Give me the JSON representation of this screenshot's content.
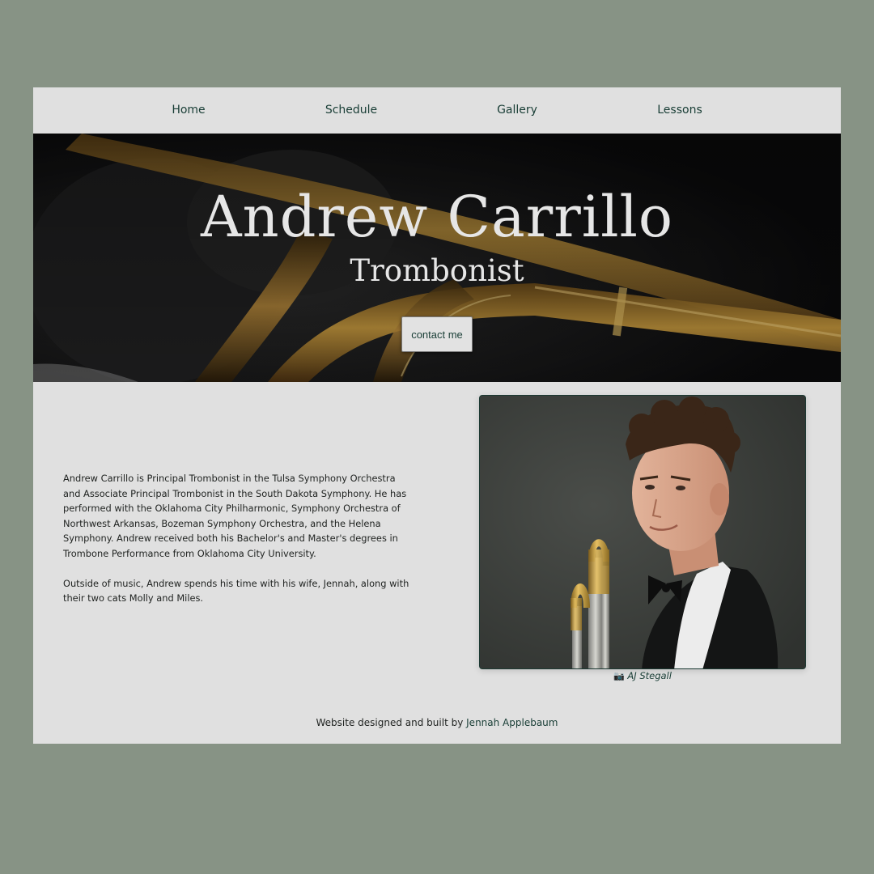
{
  "nav": {
    "items": [
      {
        "label": "Home"
      },
      {
        "label": "Schedule"
      },
      {
        "label": "Gallery"
      },
      {
        "label": "Lessons"
      }
    ]
  },
  "hero": {
    "title": "Andrew Carrillo",
    "subtitle": "Trombonist",
    "button_label": "contact me"
  },
  "bio": {
    "paragraphs": [
      "Andrew Carrillo is Principal Trombonist in the Tulsa Symphony Orchestra and Associate Principal Trombonist in the South Dakota Symphony. He has performed with the Oklahoma City Philharmonic, Symphony Orchestra of Northwest Arkansas, Bozeman Symphony Orchestra, and the Helena Symphony. Andrew received both his Bachelor's and Master's degrees in Trombone Performance from Oklahoma City University.",
      "Outside of music, Andrew spends his time with his wife, Jennah, along with their two cats Molly and Miles."
    ]
  },
  "photo": {
    "caption_icon": "camera-icon",
    "caption": "AJ Stegall"
  },
  "footer": {
    "text": "Website designed and built by",
    "link": "Jennah Applebaum"
  },
  "colors": {
    "page_background": "#879385",
    "panel_background": "#e0e0e0",
    "accent_text": "#183d35"
  }
}
